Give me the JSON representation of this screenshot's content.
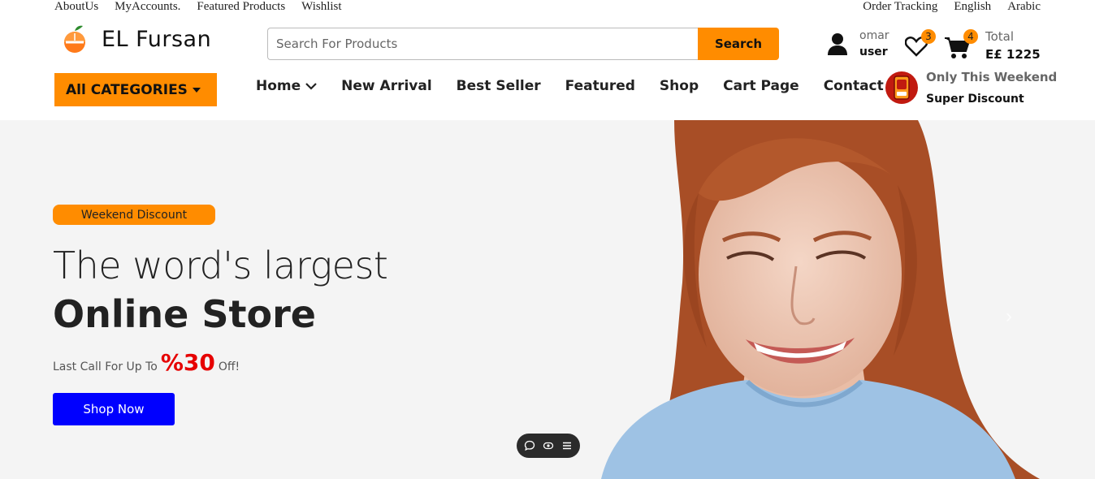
{
  "topbar": {
    "left_links": [
      "AboutUs",
      "MyAccounts.",
      "Featured Products",
      "Wishlist"
    ],
    "right_links": [
      "Order Tracking",
      "English",
      "Arabic"
    ]
  },
  "header": {
    "logo_text": "EL Fursan",
    "search": {
      "placeholder": "Search For Products",
      "button": "Search"
    },
    "user": {
      "first": "omar",
      "second": "user"
    },
    "wishlist_count": "3",
    "cart_count": "4",
    "total_label": "Total",
    "total_value": "E£ 1225"
  },
  "nav": {
    "all_categories": "All CATEGORIES",
    "items": [
      "Home",
      "New Arrival",
      "Best Seller",
      "Featured",
      "Shop",
      "Cart Page",
      "Contact Us"
    ],
    "promo_line1": "Only This Weekend",
    "promo_line2": "Super Discount"
  },
  "hero": {
    "tag": "Weekend Discount",
    "headline_light": "The word's largest",
    "headline_bold": "Online Store",
    "call_prefix": "Last Call For Up To",
    "call_percent": "%30",
    "call_suffix": "Off!",
    "cta": "Shop Now"
  },
  "colors": {
    "accent": "#ff8c00",
    "cta": "#0000ff",
    "percent": "#e60000"
  }
}
